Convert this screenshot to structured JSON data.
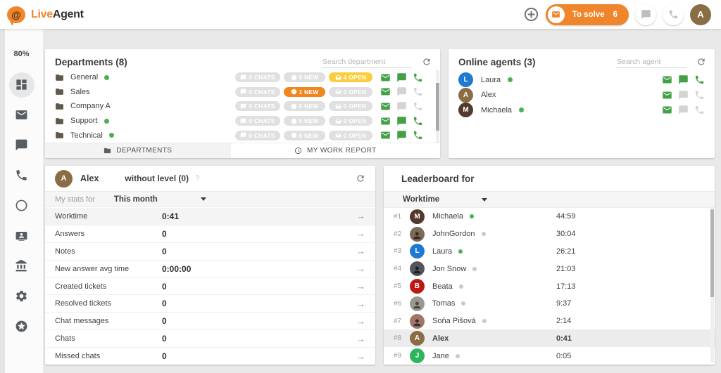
{
  "colors": {
    "brand_orange": "#f0862c",
    "chip_yellow": "#fcce3d",
    "chip_orange": "#f1861f",
    "chip_gray": "#e0e0e0",
    "action_green": "#43a047",
    "presence_green": "#4caf50",
    "presence_gray": "#c9c9c9"
  },
  "topbar": {
    "logo_live": "Live",
    "logo_agent": "Agent",
    "logo_at": "@",
    "to_solve_label": "To solve",
    "to_solve_count": "6",
    "avatar_letter": "A"
  },
  "sidebar": {
    "usage_percent": "80%",
    "items": [
      {
        "icon": "dashboard-icon",
        "active": true
      },
      {
        "icon": "mail-icon",
        "active": false
      },
      {
        "icon": "chat-icon",
        "active": false
      },
      {
        "icon": "phone-icon",
        "active": false
      },
      {
        "icon": "history-icon",
        "active": false
      },
      {
        "icon": "contacts-icon",
        "active": false
      },
      {
        "icon": "bank-icon",
        "active": false
      },
      {
        "icon": "settings-icon",
        "active": false
      },
      {
        "icon": "star-icon",
        "active": false
      }
    ]
  },
  "departments": {
    "title": "Departments (8)",
    "search_placeholder": "Search department",
    "rows": [
      {
        "name": "General",
        "online": true,
        "chats": {
          "label": "0 CHATS",
          "variant": "gray"
        },
        "new": {
          "label": "0 NEW",
          "variant": "gray"
        },
        "open": {
          "label": "4 OPEN",
          "variant": "yellow"
        },
        "mail": "green",
        "chat": "green",
        "phone": "green"
      },
      {
        "name": "Sales",
        "online": false,
        "chats": {
          "label": "0 CHATS",
          "variant": "gray"
        },
        "new": {
          "label": "1 NEW",
          "variant": "orange"
        },
        "open": {
          "label": "0 OPEN",
          "variant": "gray"
        },
        "mail": "green",
        "chat": "gray",
        "phone": "gray"
      },
      {
        "name": "Company A",
        "online": false,
        "chats": {
          "label": "0 CHATS",
          "variant": "gray"
        },
        "new": {
          "label": "0 NEW",
          "variant": "gray"
        },
        "open": {
          "label": "0 OPEN",
          "variant": "gray"
        },
        "mail": "green",
        "chat": "gray",
        "phone": "gray"
      },
      {
        "name": "Support",
        "online": true,
        "chats": {
          "label": "0 CHATS",
          "variant": "gray"
        },
        "new": {
          "label": "0 NEW",
          "variant": "gray"
        },
        "open": {
          "label": "0 OPEN",
          "variant": "gray"
        },
        "mail": "green",
        "chat": "green",
        "phone": "green"
      },
      {
        "name": "Technical",
        "online": true,
        "chats": {
          "label": "0 CHATS",
          "variant": "gray"
        },
        "new": {
          "label": "0 NEW",
          "variant": "gray"
        },
        "open": {
          "label": "0 OPEN",
          "variant": "gray"
        },
        "mail": "green",
        "chat": "green",
        "phone": "green"
      }
    ],
    "tabs": [
      {
        "label": "DEPARTMENTS",
        "active": true
      },
      {
        "label": "MY WORK REPORT",
        "active": false
      }
    ]
  },
  "agents": {
    "title": "Online agents (3)",
    "search_placeholder": "Search agent",
    "rows": [
      {
        "name": "Laura",
        "avatar": {
          "type": "initial",
          "letter": "L",
          "color": "#1d79d2"
        },
        "presence": "online",
        "mail": "green",
        "chat": "green",
        "phone": "green"
      },
      {
        "name": "Alex",
        "avatar": {
          "type": "initial",
          "letter": "A",
          "color": "#8a6d45"
        },
        "presence": null,
        "mail": "green",
        "chat": "gray",
        "phone": "gray"
      },
      {
        "name": "Michaela",
        "avatar": {
          "type": "initial",
          "letter": "M",
          "color": "#53382c"
        },
        "presence": "online",
        "mail": "green",
        "chat": "gray",
        "phone": "gray"
      }
    ]
  },
  "stats": {
    "agent_name": "Alex",
    "avatar": {
      "letter": "A",
      "color": "#8a6d45"
    },
    "level": "without level (0)",
    "help": "?",
    "filter_label": "My stats for",
    "filter_value": "This month",
    "rows": [
      {
        "label": "Worktime",
        "value": "0:41",
        "highlight": true
      },
      {
        "label": "Answers",
        "value": "0",
        "highlight": false
      },
      {
        "label": "Notes",
        "value": "0",
        "highlight": false
      },
      {
        "label": "New answer avg time",
        "value": "0:00:00",
        "highlight": false
      },
      {
        "label": "Created tickets",
        "value": "0",
        "highlight": false
      },
      {
        "label": "Resolved tickets",
        "value": "0",
        "highlight": false
      },
      {
        "label": "Chat messages",
        "value": "0",
        "highlight": false
      },
      {
        "label": "Chats",
        "value": "0",
        "highlight": false
      },
      {
        "label": "Missed chats",
        "value": "0",
        "highlight": false
      }
    ]
  },
  "leaderboard": {
    "title": "Leaderboard for",
    "metric": "Worktime",
    "rows": [
      {
        "rank": "#1",
        "name": "Michaela",
        "value": "44:59",
        "presence": "online",
        "highlight": false,
        "avatar": {
          "type": "initial",
          "letter": "M",
          "color": "#53382c"
        }
      },
      {
        "rank": "#2",
        "name": "JohnGordon",
        "value": "30:04",
        "presence": "away",
        "highlight": false,
        "avatar": {
          "type": "photo",
          "bg": "#7a6a58",
          "fg": "#33291f"
        }
      },
      {
        "rank": "#3",
        "name": "Laura",
        "value": "26:21",
        "presence": "online",
        "highlight": false,
        "avatar": {
          "type": "initial",
          "letter": "L",
          "color": "#1d79d2"
        }
      },
      {
        "rank": "#4",
        "name": "Jon Snow",
        "value": "21:03",
        "presence": "away",
        "highlight": false,
        "avatar": {
          "type": "photo",
          "bg": "#54565c",
          "fg": "#1e1e24"
        }
      },
      {
        "rank": "#5",
        "name": "Beata",
        "value": "17:13",
        "presence": "away",
        "highlight": false,
        "avatar": {
          "type": "initial",
          "letter": "B",
          "color": "#bf1712"
        }
      },
      {
        "rank": "#6",
        "name": "Tomas",
        "value": "9:37",
        "presence": "away",
        "highlight": false,
        "avatar": {
          "type": "photo",
          "bg": "#9a988f",
          "fg": "#4b4a43"
        }
      },
      {
        "rank": "#7",
        "name": "Soňa Pišová",
        "value": "2:14",
        "presence": "away",
        "highlight": false,
        "avatar": {
          "type": "photo",
          "bg": "#a0756a",
          "fg": "#3c2a26"
        }
      },
      {
        "rank": "#8",
        "name": "Alex",
        "value": "0:41",
        "presence": null,
        "highlight": true,
        "avatar": {
          "type": "initial",
          "letter": "A",
          "color": "#8a6d45"
        }
      },
      {
        "rank": "#9",
        "name": "Jane",
        "value": "0:05",
        "presence": "away",
        "highlight": false,
        "avatar": {
          "type": "initial",
          "letter": "J",
          "color": "#2cb55c"
        }
      }
    ]
  }
}
